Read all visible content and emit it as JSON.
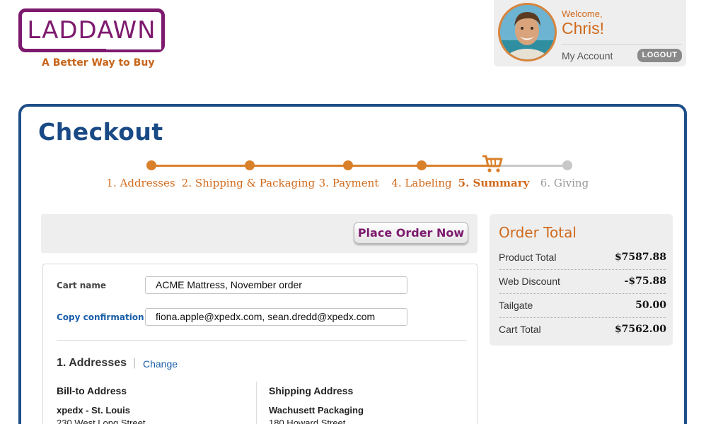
{
  "brand": {
    "logo_text": "LADDAWN",
    "tagline": "A Better Way to Buy",
    "color": "#7d1a6e"
  },
  "user": {
    "welcome": "Welcome,",
    "name": "Chris!",
    "my_account": "My Account",
    "logout": "LOGOUT"
  },
  "page": {
    "title": "Checkout"
  },
  "steps": [
    {
      "label": "1. Addresses",
      "state": "done"
    },
    {
      "label": "2. Shipping & Packaging",
      "state": "done"
    },
    {
      "label": "3. Payment",
      "state": "done"
    },
    {
      "label": "4. Labeling",
      "state": "done"
    },
    {
      "label": "5. Summary",
      "state": "current",
      "icon": "cart-icon"
    },
    {
      "label": "6. Giving",
      "state": "pending"
    }
  ],
  "actions": {
    "place_order": "Place Order Now"
  },
  "form": {
    "cart_name_label": "Cart name",
    "cart_name_value": "ACME Mattress, November order",
    "copy_label": "Copy confirmation to",
    "copy_value": "fiona.apple@xpedx.com, sean.dredd@xpedx.com"
  },
  "addresses": {
    "title": "1. Addresses",
    "separator": "|",
    "change": "Change",
    "bill_to": {
      "heading": "Bill-to Address",
      "name": "xpedx - St. Louis",
      "line1": "230 West Long Street"
    },
    "ship_to": {
      "heading": "Shipping Address",
      "name": "Wachusett Packaging",
      "line1": "180 Howard Street"
    }
  },
  "order_total": {
    "title": "Order Total",
    "rows": [
      {
        "label": "Product Total",
        "value": "$7587.88"
      },
      {
        "label": "Web Discount",
        "value": "-$75.88"
      },
      {
        "label": "Tailgate",
        "value": "50.00"
      },
      {
        "label": "Cart Total",
        "value": "$7562.00"
      }
    ]
  },
  "colors": {
    "accent_orange": "#d9802b",
    "brand_blue": "#1e4f88",
    "step_pending": "#c8c8c8",
    "link_blue": "#1a5ea8"
  }
}
